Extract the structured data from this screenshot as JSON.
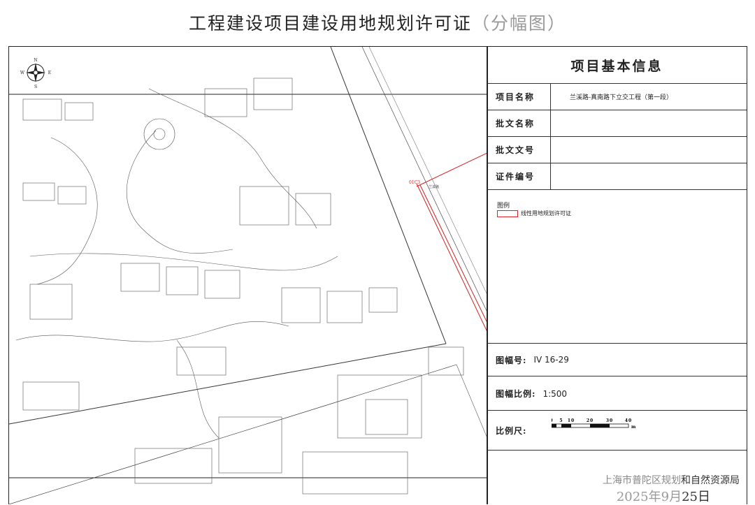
{
  "title": {
    "main": "工程建设项目建设用地规划许可证",
    "sub": "（分幅图）"
  },
  "map": {
    "compass": {
      "n": "N",
      "s": "S",
      "e": "E",
      "w": "W"
    },
    "point_label": "01C3",
    "road_label": "兰溪路"
  },
  "panel": {
    "header": "项目基本信息",
    "rows": [
      {
        "label": "项目名称",
        "value": "兰溪路-真南路下立交工程（第一段）"
      },
      {
        "label": "批文名称",
        "value": ""
      },
      {
        "label": "批文文号",
        "value": ""
      },
      {
        "label": "证件编号",
        "value": ""
      }
    ],
    "legend": {
      "title": "图例",
      "item": "线性用地规划许可证",
      "item_color": "#d22222"
    },
    "sheet_no_label": "图幅号:",
    "sheet_no": "IV 16-29",
    "scale_label": "图幅比例:",
    "scale": "1:500",
    "ruler_label": "比例尺:",
    "ruler_ticks": [
      "0",
      "5",
      "10",
      "20",
      "30",
      "40"
    ],
    "ruler_unit": "m",
    "issuer_faded": "上海市普陀区规划",
    "issuer_dark": "和自然资源局",
    "date_faded": "2025年9月",
    "date_dark": "25日"
  }
}
